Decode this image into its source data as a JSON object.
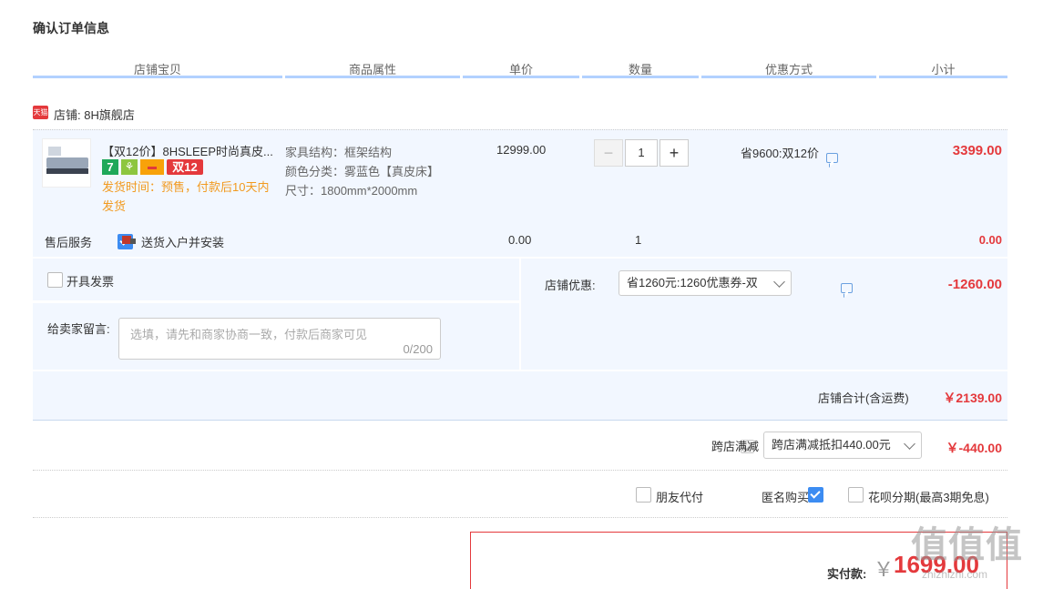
{
  "page_title": "确认订单信息",
  "columns": [
    "店铺宝贝",
    "商品属性",
    "单价",
    "数量",
    "优惠方式",
    "小计"
  ],
  "shop": {
    "badge": "天猫",
    "label": "店铺: 8H旗舰店"
  },
  "item": {
    "name": "【双12价】8HSLEEP时尚真皮...",
    "tags": [
      "7",
      "⚘",
      "▬",
      "双12"
    ],
    "ship_time": "发货时间：预售，付款后10天内发货",
    "attrs": [
      "家具结构：框架结构",
      "颜色分类：雾蓝色【真皮床】",
      "尺寸：1800mm*2000mm"
    ],
    "unit_price": "12999.00",
    "quantity": "1",
    "discount": "省9600:双12价",
    "subtotal": "3399.00"
  },
  "service": {
    "label": "售后服务",
    "name": "送货入户并安装",
    "price": "0.00",
    "qty": "1",
    "subtotal": "0.00"
  },
  "invoice_label": "开具发票",
  "message": {
    "label": "给卖家留言:",
    "placeholder": "选填，请先和商家协商一致，付款后商家可见",
    "counter": "0/200"
  },
  "shop_coupon": {
    "label": "店铺优惠:",
    "value": "省1260元:1260优惠券-双",
    "amount": "-1260.00"
  },
  "shop_total": {
    "label": "店铺合计(含运费)",
    "value": "￥2139.00"
  },
  "cross_store": {
    "label": "跨店满减",
    "value": "跨店满减抵扣440.00元",
    "amount": "￥-440.00"
  },
  "options": {
    "friend_pay": "朋友代付",
    "anonymous": "匿名购买",
    "huabei": "花呗分期(最高3期免息)"
  },
  "final": {
    "label": "实付款:",
    "currency": "￥",
    "amount": "1699.00"
  },
  "watermark": "值值值",
  "watermark_site": "zhizhizhi.com",
  "colors": {
    "accent_blue": "#3c8cf2",
    "price_red": "#e4393c",
    "header_border": "#b2d1ff"
  }
}
